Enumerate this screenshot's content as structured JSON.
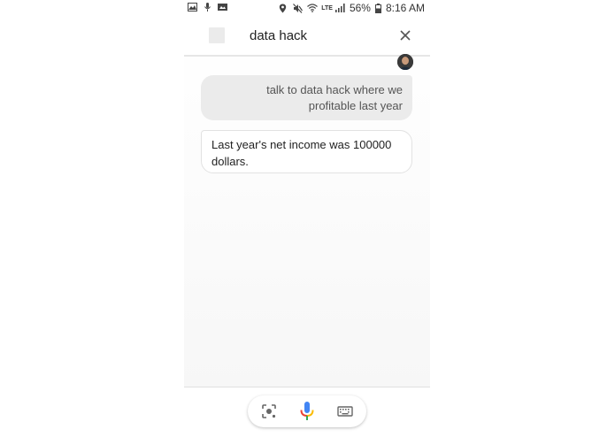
{
  "status_bar": {
    "lte": "LTE",
    "battery": "56%",
    "time": "8:16 AM"
  },
  "header": {
    "title": "data hack"
  },
  "conversation": {
    "user_message": "talk to data hack where we profitable last year",
    "assistant_message": "Last year's net income was 100000 dollars."
  },
  "icons": {
    "close": "close-icon",
    "lens": "lens-icon",
    "mic": "microphone-icon",
    "keyboard": "keyboard-icon"
  },
  "colors": {
    "mic_blue": "#4285F4",
    "mic_red": "#EA4335",
    "mic_yellow": "#FBBC05",
    "mic_green": "#34A853",
    "user_bubble": "#ebebeb"
  }
}
